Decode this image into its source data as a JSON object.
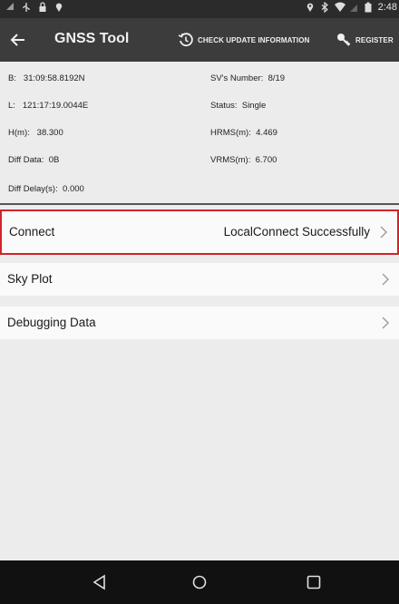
{
  "status_bar": {
    "time": "2:48",
    "left_icons": [
      "signal-icon",
      "usb-icon",
      "lock-icon",
      "location-pin-icon"
    ],
    "right_icons": [
      "location-icon",
      "bluetooth-icon",
      "wifi-icon",
      "no-sim-icon",
      "battery-icon"
    ]
  },
  "app_bar": {
    "title": "GNSS Tool",
    "check_update_label": "CHECK UPDATE INFORMATION",
    "register_label": "REGISTER"
  },
  "info": {
    "b_label": "B:",
    "b_value": "31:09:58.8192N",
    "l_label": "L:",
    "l_value": "121:17:19.0044E",
    "h_label": "H(m):",
    "h_value": "38.300",
    "diff_data_label": "Diff Data:",
    "diff_data_value": "0B",
    "diff_delay_label": "Diff Delay(s):",
    "diff_delay_value": "0.000",
    "sv_label": "SV's Number:",
    "sv_value": "8/19",
    "status_label": "Status:",
    "status_value": "Single",
    "hrms_label": "HRMS(m):",
    "hrms_value": "4.469",
    "vrms_label": "VRMS(m):",
    "vrms_value": "6.700"
  },
  "menu": {
    "connect_label": "Connect",
    "connect_value": "LocalConnect Successfully",
    "sky_plot_label": "Sky Plot",
    "debugging_label": "Debugging Data"
  },
  "colors": {
    "highlight_border": "#d2232a",
    "app_bar": "#3c3c3c",
    "status_bar": "#2b2b2b",
    "nav_bar": "#111111"
  }
}
